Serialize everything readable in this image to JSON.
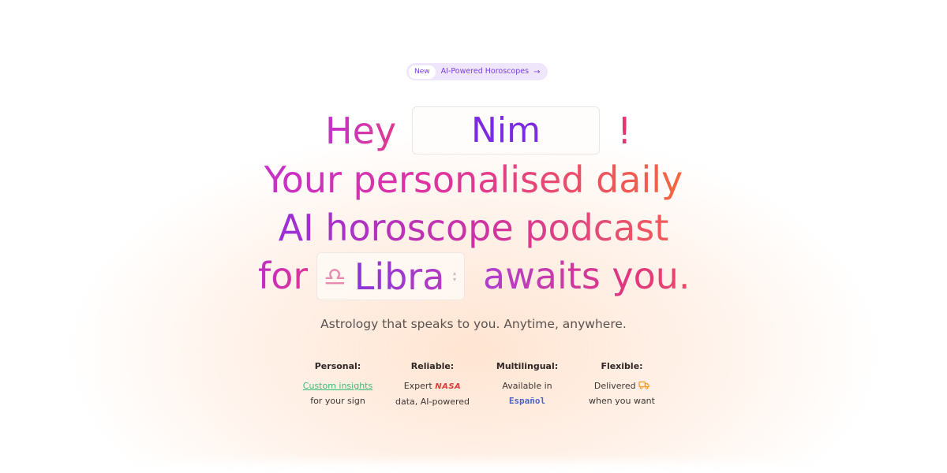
{
  "badge": {
    "new_label": "New",
    "text": "AI-Powered Horoscopes",
    "arrow": "→"
  },
  "headline": {
    "greeting": "Hey",
    "name_value": "Nim",
    "exclaim": "!",
    "line2": "Your personalised daily",
    "line3": "AI horoscope podcast",
    "for_word": "for",
    "sign_symbol": "♎",
    "sign_value": "Libra",
    "line4_end": "awaits you."
  },
  "subtitle": "Astrology that speaks to you. Anytime, anywhere.",
  "features": [
    {
      "title": "Personal:",
      "line1": "Custom insights",
      "line2": "for your sign"
    },
    {
      "title": "Reliable:",
      "line1_pre": "Expert",
      "line1_logo": "NASA",
      "line2": "data, AI-powered"
    },
    {
      "title": "Multilingual:",
      "line1": "Available in",
      "line2": "Español"
    },
    {
      "title": "Flexible:",
      "line1": "Delivered",
      "line2": "when you want"
    }
  ],
  "icons": {
    "badge_arrow": "arrow-right-icon",
    "sign": "libra-icon",
    "select": "chevron-updown-icon",
    "delivery": "truck-icon"
  },
  "colors": {
    "accent_purple": "#7c2be0",
    "gradient_start": "#c731c7",
    "gradient_end": "#f4663e",
    "link_green": "#3ebb78",
    "nasa_red": "#e03a3a",
    "espanol_blue": "#4d63c9",
    "truck_orange": "#f29a2a"
  }
}
